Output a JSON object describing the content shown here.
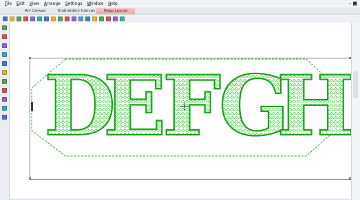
{
  "menu": {
    "items": [
      "File",
      "Edit",
      "View",
      "Arrange",
      "Settings",
      "Window",
      "Help"
    ],
    "window_controls": "– ■"
  },
  "tabs": [
    {
      "label": "Art Canvas",
      "active": false
    },
    {
      "label": "Embroidery Canvas",
      "active": false
    },
    {
      "label": "Hoop Layout",
      "active": true
    }
  ],
  "design": {
    "letters": "DEFGH",
    "stitch_color": "#22cc22",
    "outline_color": "#1aa51a",
    "border_style": "dashed-octagon"
  },
  "colors": {
    "menubar": "#f1f3f6",
    "active_tab": "#e8a7a7",
    "canvas": "#ffffff",
    "hoop_frame": "#777777"
  },
  "toolbar_icons": [
    "new-icon",
    "open-icon",
    "save-icon",
    "print-icon",
    "cut-icon",
    "copy-icon",
    "paste-icon",
    "undo-icon",
    "redo-icon",
    "stitch-icon",
    "color-icon",
    "zoom-in-icon",
    "zoom-out-icon",
    "grid-icon",
    "align-icon",
    "group-icon",
    "rotate-icon",
    "mirror-icon"
  ],
  "left_tools": [
    "pointer-icon",
    "reshape-icon",
    "text-icon",
    "shape-icon",
    "fill-icon",
    "line-icon",
    "pen-icon",
    "zoom-icon",
    "pan-icon",
    "layer-icon",
    "hoop-icon"
  ]
}
